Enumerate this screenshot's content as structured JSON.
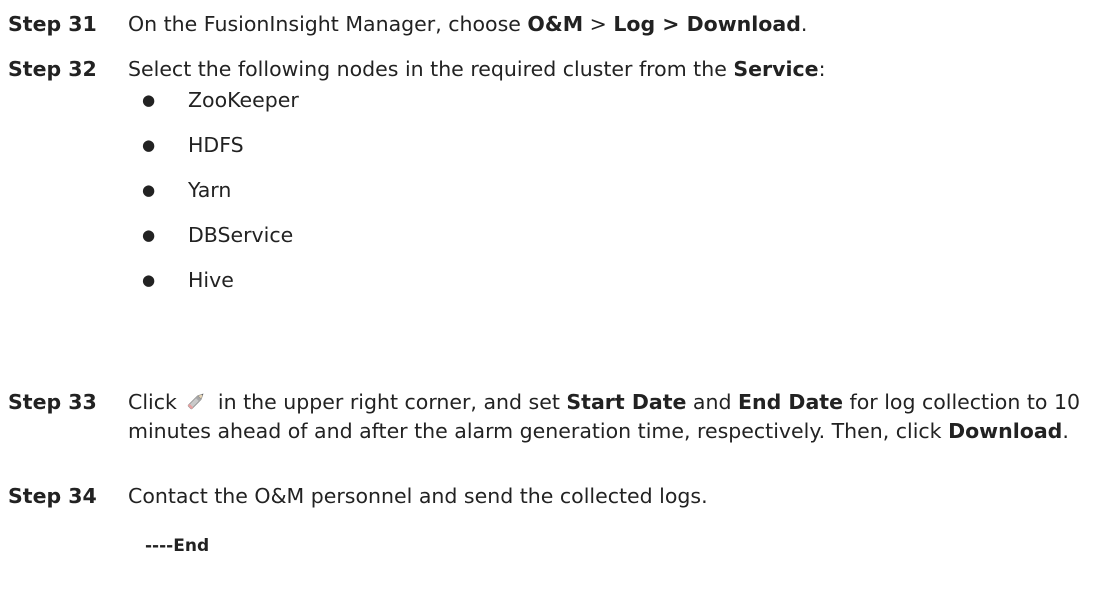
{
  "step31": {
    "label": "Step 31",
    "text_prefix": "On the FusionInsight Manager, choose ",
    "menu1": "O&M",
    "separator": " > ",
    "menu2": "Log > Download",
    "text_suffix": "."
  },
  "step32": {
    "label": "Step 32",
    "text_prefix": "Select the following nodes in the required cluster from the ",
    "bold": "Service",
    "text_suffix": ":",
    "items": [
      "ZooKeeper",
      "HDFS",
      "Yarn",
      "DBService",
      "Hive"
    ]
  },
  "step33": {
    "label": "Step 33",
    "text_click": "Click ",
    "icon": "pencil-icon",
    "text_1": " in the upper right corner, and set ",
    "bold_start": "Start Date",
    "text_and": " and ",
    "bold_end": "End Date",
    "text_2": " for log collection to 10 minutes ahead of and after the alarm generation time, respectively. Then, click ",
    "bold_download": "Download",
    "text_3": "."
  },
  "step34": {
    "label": "Step 34",
    "text": "Contact the O&M personnel and send the collected logs."
  },
  "end_marker": "----End"
}
